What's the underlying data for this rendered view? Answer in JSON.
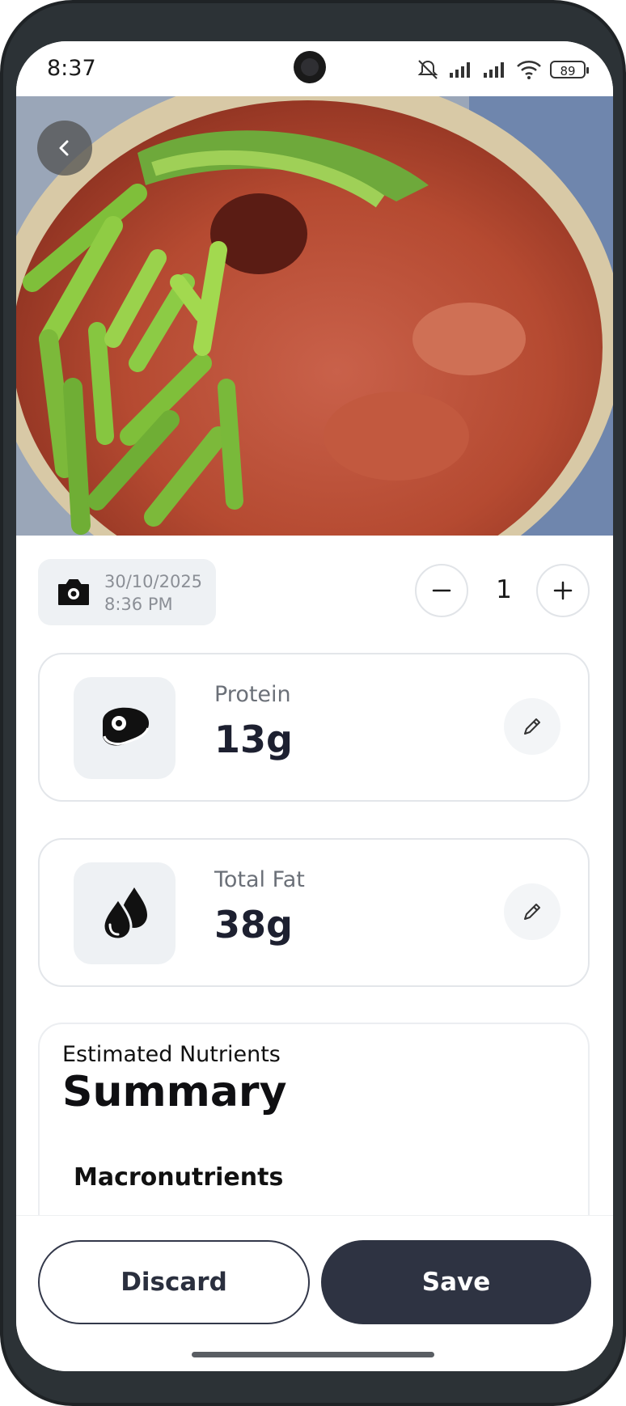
{
  "status_bar": {
    "time": "8:37",
    "battery": "89"
  },
  "header": {
    "back_icon": "chevron-left-icon"
  },
  "hero_image": {
    "description_icon": "food-photo"
  },
  "meal_meta": {
    "date": "30/10/2025",
    "time": "8:36 PM",
    "icon": "camera-icon"
  },
  "quantity": {
    "value": "1",
    "decrement_icon": "minus-icon",
    "increment_icon": "plus-icon"
  },
  "nutrients": [
    {
      "label": "Protein",
      "value": "13g",
      "icon": "steak-icon"
    },
    {
      "label": "Total Fat",
      "value": "38g",
      "icon": "droplets-icon"
    }
  ],
  "summary": {
    "subtitle": "Estimated Nutrients",
    "title": "Summary",
    "section": "Macronutrients"
  },
  "actions": {
    "discard": "Discard",
    "save": "Save"
  },
  "colors": {
    "primary": "#2e3342",
    "chip_bg": "#eef1f4",
    "border": "#e3e6ea"
  }
}
